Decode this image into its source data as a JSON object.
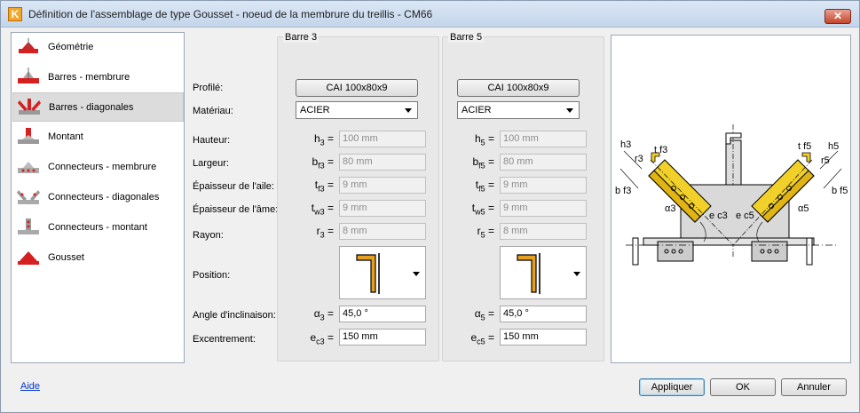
{
  "window": {
    "title": "Définition de l'assemblage de type Gousset - noeud de la membrure du treillis - CM66",
    "app_icon_letter": "K",
    "close_label": "✕"
  },
  "sidebar": {
    "items": [
      {
        "label": "Géométrie",
        "active": false
      },
      {
        "label": "Barres - membrure",
        "active": false
      },
      {
        "label": "Barres - diagonales",
        "active": true
      },
      {
        "label": "Montant",
        "active": false
      },
      {
        "label": "Connecteurs - membrure",
        "active": false
      },
      {
        "label": "Connecteurs - diagonales",
        "active": false
      },
      {
        "label": "Connecteurs - montant",
        "active": false
      },
      {
        "label": "Gousset",
        "active": false
      }
    ]
  },
  "labels": {
    "profile": "Profilé:",
    "material": "Matériau:",
    "height": "Hauteur:",
    "width": "Largeur:",
    "flange_thickness": "Épaisseur de l'aile:",
    "web_thickness": "Épaisseur de l'âme:",
    "radius": "Rayon:",
    "position": "Position:",
    "angle": "Angle d'inclinaison:",
    "eccentricity": "Excentrement:"
  },
  "bar3": {
    "title": "Barre 3",
    "profile": "CAI 100x80x9",
    "material": "ACIER",
    "h_sym": "h",
    "h_sub": "3",
    "h": "100 mm",
    "bf_sym": "b",
    "bf_sub": "f3",
    "bf": "80 mm",
    "tf_sym": "t",
    "tf_sub": "f3",
    "tf": "9 mm",
    "tw_sym": "t",
    "tw_sub": "w3",
    "tw": "9 mm",
    "r_sym": "r",
    "r_sub": "3",
    "r": "8 mm",
    "alpha_sym": "α",
    "alpha_sub": "3",
    "alpha": "45,0 °",
    "e_sym": "e",
    "e_sub": "c3",
    "e": "150 mm"
  },
  "bar5": {
    "title": "Barre 5",
    "profile": "CAI 100x80x9",
    "material": "ACIER",
    "h_sym": "h",
    "h_sub": "5",
    "h": "100 mm",
    "bf_sym": "b",
    "bf_sub": "f5",
    "bf": "80 mm",
    "tf_sym": "t",
    "tf_sub": "f5",
    "tf": "9 mm",
    "tw_sym": "t",
    "tw_sub": "w5",
    "tw": "9 mm",
    "r_sym": "r",
    "r_sub": "5",
    "r": "8 mm",
    "alpha_sym": "α",
    "alpha_sub": "5",
    "alpha": "45,0 °",
    "e_sym": "e",
    "e_sub": "c5",
    "e": "150 mm"
  },
  "preview": {
    "h3": "h3",
    "r3": "r3",
    "tf3": "t f3",
    "bf3": "b f3",
    "alpha3": "α3",
    "ec3": "e c3",
    "h5": "h5",
    "r5": "r5",
    "tf5": "t f5",
    "bf5": "b f5",
    "alpha5": "α5",
    "ec5": "e c5"
  },
  "footer": {
    "help": "Aide",
    "apply": "Appliquer",
    "ok": "OK",
    "cancel": "Annuler"
  },
  "colors": {
    "accent_yellow": "#f2d02a",
    "icon_red": "#d42020",
    "select_bg": "#dcdcdc"
  }
}
